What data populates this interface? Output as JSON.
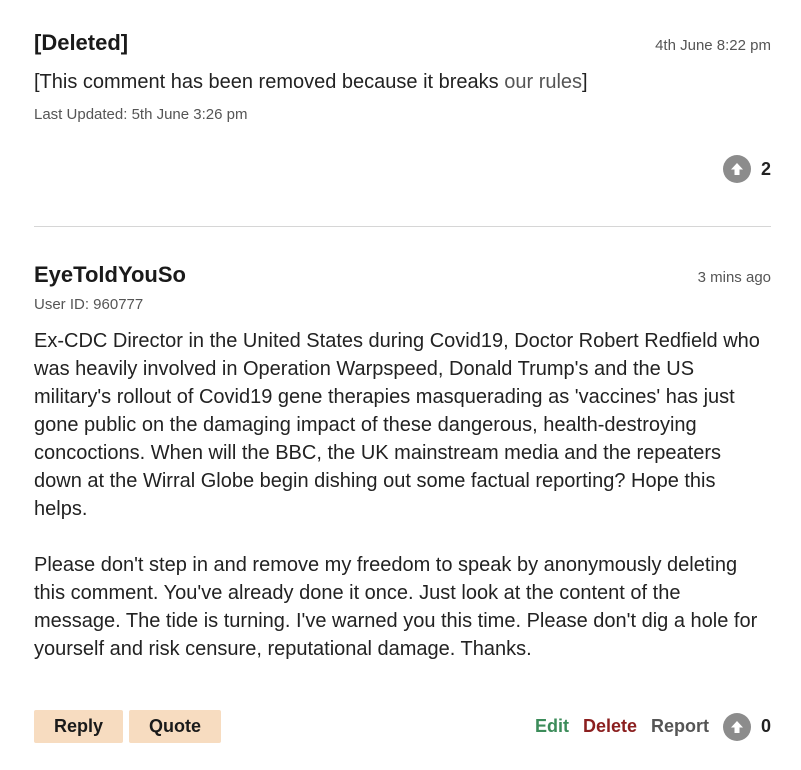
{
  "comments": [
    {
      "author": "[Deleted]",
      "time": "4th June 8:22 pm",
      "body_prefix": "[This comment has been removed because it breaks ",
      "body_link": "our rules",
      "body_suffix": "]",
      "last_updated": "Last Updated: 5th June 3:26 pm",
      "votes": "2"
    },
    {
      "author": "EyeToldYouSo",
      "time": "3 mins ago",
      "user_id": "User ID: 960777",
      "paragraph1": "Ex-CDC Director in the United States during Covid19, Doctor Robert Redfield who was heavily involved in Operation Warpspeed, Donald Trump's and the US military's rollout of Covid19 gene therapies masquerading as 'vaccines' has just gone public on the damaging impact of these dangerous, health-destroying concoctions. When will the BBC, the UK mainstream media and the repeaters down at the Wirral Globe begin dishing out some factual reporting? Hope this helps.",
      "paragraph2": "Please don't step in and remove my freedom to speak by anonymously deleting this comment. You've already done it once. Just look at the content of the message. The tide is turning. I've warned you this time. Please don't dig a hole for yourself and risk censure, reputational damage. Thanks.",
      "votes": "0"
    }
  ],
  "actions": {
    "reply": "Reply",
    "quote": "Quote",
    "edit": "Edit",
    "delete": "Delete",
    "report": "Report"
  },
  "colors": {
    "button_bg": "#f7dcc0",
    "edit": "#3c8c5a",
    "delete": "#8b1f1f",
    "vote_icon": "#8c8c8c"
  },
  "icons": {
    "upvote": "upvote-arrow-icon"
  }
}
